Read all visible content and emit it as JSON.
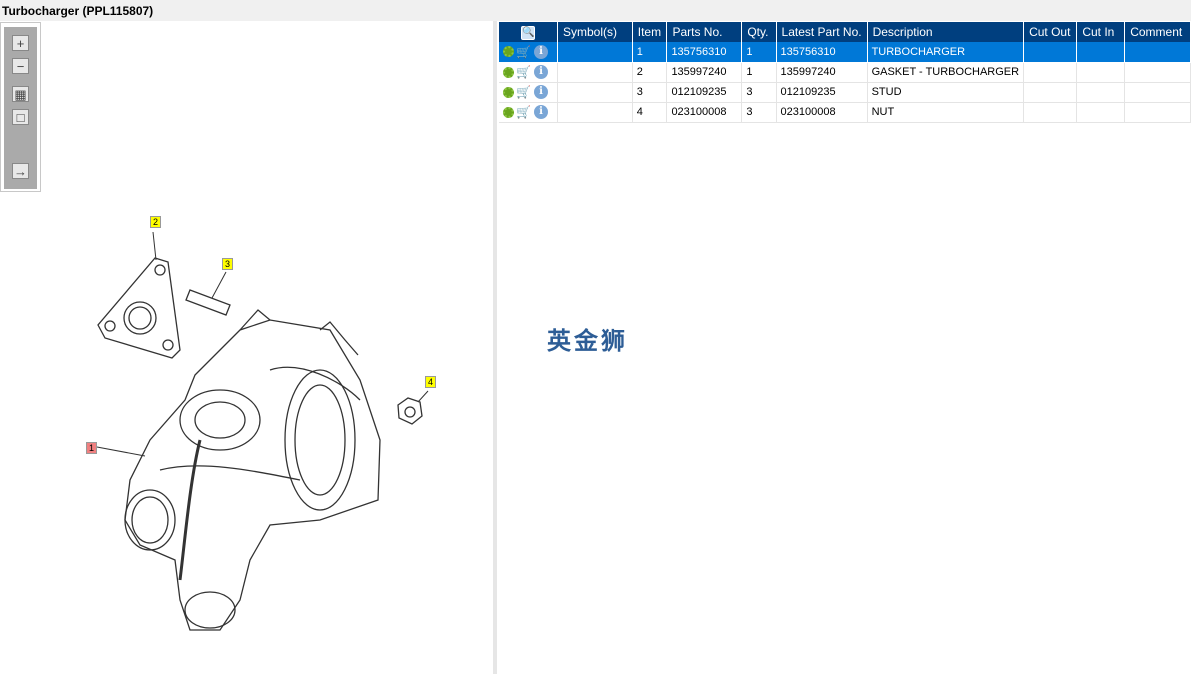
{
  "title": "Turbocharger (PPL115807)",
  "toolbar": [
    {
      "icon": "zoom-in-icon",
      "glyph": "+"
    },
    {
      "icon": "zoom-out-icon",
      "glyph": "−"
    },
    {
      "icon": "fit-all-icon",
      "glyph": "▦"
    },
    {
      "icon": "fit-window-icon",
      "glyph": "□"
    },
    {
      "icon": "export-list-icon",
      "glyph": "→"
    }
  ],
  "callouts": [
    {
      "label": "1",
      "color": "#f08080"
    },
    {
      "label": "2",
      "color": "#ffff00"
    },
    {
      "label": "3",
      "color": "#ffff00"
    },
    {
      "label": "4",
      "color": "#ffff00"
    }
  ],
  "table": {
    "headers": [
      "Symbol(s)",
      "Item",
      "Parts No.",
      "Qty.",
      "Latest Part No.",
      "Description",
      "Cut Out",
      "Cut In",
      "Comment"
    ],
    "rows": [
      {
        "symbols": "",
        "item": "1",
        "parts_no": "135756310",
        "qty": "1",
        "latest": "135756310",
        "description": "TURBOCHARGER",
        "cut_out": "",
        "cut_in": "",
        "comment": "",
        "selected": true
      },
      {
        "symbols": "",
        "item": "2",
        "parts_no": "135997240",
        "qty": "1",
        "latest": "135997240",
        "description": "GASKET - TURBOCHARGER",
        "cut_out": "",
        "cut_in": "",
        "comment": ""
      },
      {
        "symbols": "",
        "item": "3",
        "parts_no": "012109235",
        "qty": "3",
        "latest": "012109235",
        "description": "STUD",
        "cut_out": "",
        "cut_in": "",
        "comment": ""
      },
      {
        "symbols": "",
        "item": "4",
        "parts_no": "023100008",
        "qty": "3",
        "latest": "023100008",
        "description": "NUT",
        "cut_out": "",
        "cut_in": "",
        "comment": ""
      }
    ]
  },
  "watermark": "英金狮",
  "colors": {
    "header": "#003f7f",
    "selected": "#0078d7"
  }
}
